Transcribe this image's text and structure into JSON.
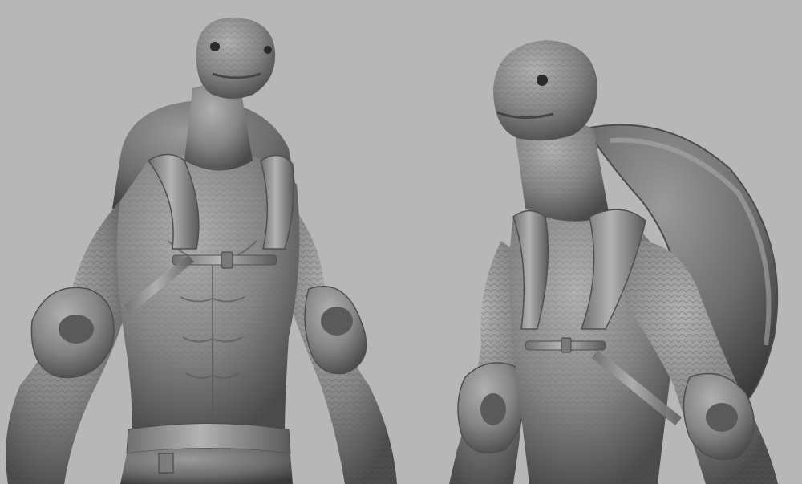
{
  "scene": {
    "background_color": "#b7b7b7",
    "clay_color": "#8a8a8a",
    "views": [
      {
        "name": "front-view"
      },
      {
        "name": "three-quarter-view"
      }
    ]
  }
}
